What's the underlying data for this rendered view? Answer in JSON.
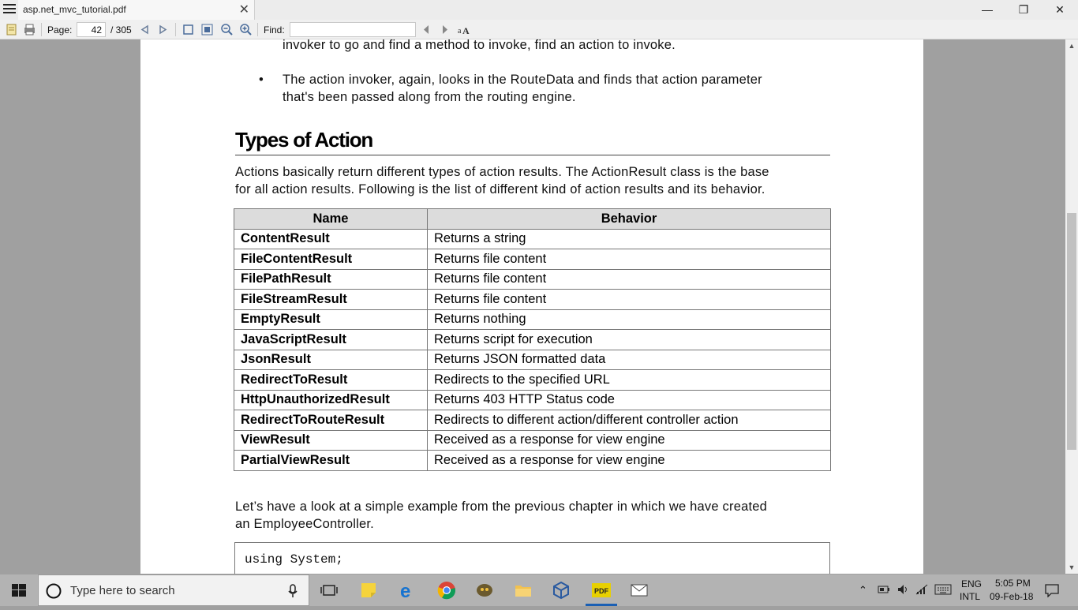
{
  "window": {
    "tab_title": "asp.net_mvc_tutorial.pdf",
    "close_glyph": "✕",
    "minimize_glyph": "—",
    "restore_glyph": "❐",
    "window_close_glyph": "✕"
  },
  "toolbar": {
    "page_label": "Page:",
    "page_value": "42",
    "page_total": "/ 305",
    "find_label": "Find:",
    "find_value": ""
  },
  "document": {
    "intro_line": "invoker to go and find a method to invoke, find an action to invoke.",
    "bullet": "•",
    "bullet_line1": "The action invoker, again, looks in the RouteData and finds that action parameter",
    "bullet_line2": "that's been passed along from the routing engine.",
    "heading": "Types of Action",
    "para_line1": "Actions basically return different types of action results. The ActionResult class is the base",
    "para_line2": "for all action results. Following is the list of different kind of action results and its behavior.",
    "table_headers": [
      "Name",
      "Behavior"
    ],
    "table_rows": [
      [
        "ContentResult",
        "Returns a string"
      ],
      [
        "FileContentResult",
        "Returns file content"
      ],
      [
        "FilePathResult",
        "Returns file content"
      ],
      [
        "FileStreamResult",
        "Returns file content"
      ],
      [
        "EmptyResult",
        "Returns nothing"
      ],
      [
        "JavaScriptResult",
        "Returns script for execution"
      ],
      [
        "JsonResult",
        "Returns JSON formatted data"
      ],
      [
        "RedirectToResult",
        "Redirects to the specified URL"
      ],
      [
        "HttpUnauthorizedResult",
        "Returns 403 HTTP Status code"
      ],
      [
        "RedirectToRouteResult",
        "Redirects to different action/different controller action"
      ],
      [
        "ViewResult",
        "Received as a response for view engine"
      ],
      [
        "PartialViewResult",
        "Received as a response for view engine"
      ]
    ],
    "para2_line1": "Let’s have a look at a simple example from the previous chapter in which we have created",
    "para2_line2": "an EmployeeController.",
    "code_line": "using System;"
  },
  "taskbar": {
    "search_placeholder": "Type here to search",
    "lang_top": "ENG",
    "lang_bottom": "INTL",
    "time": "5:05 PM",
    "date": "09-Feb-18"
  },
  "colors": {
    "accent": "#4a6c9b",
    "table_header_bg": "#dcdcdc",
    "viewer_bg": "#a0a0a0"
  }
}
